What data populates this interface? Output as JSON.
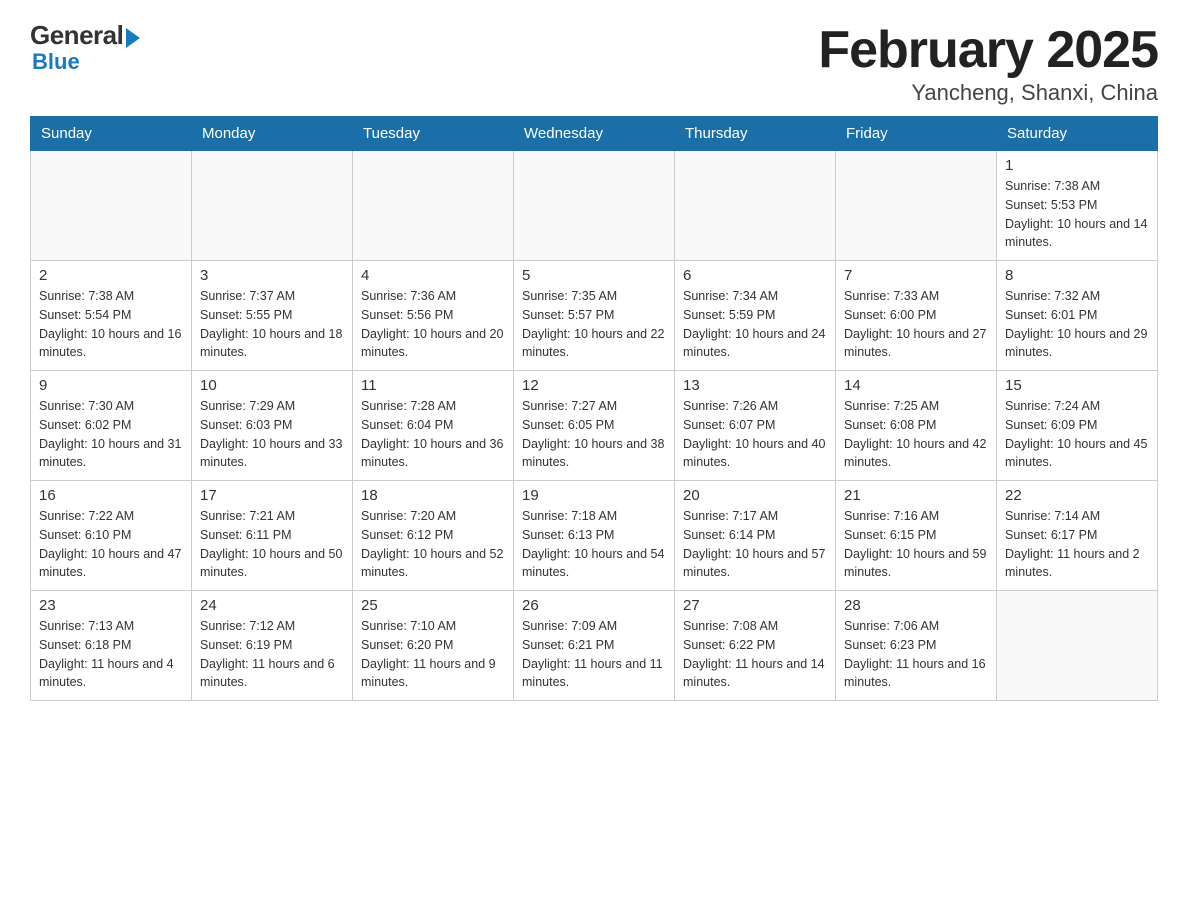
{
  "logo": {
    "general": "General",
    "blue": "Blue"
  },
  "title": "February 2025",
  "subtitle": "Yancheng, Shanxi, China",
  "days_of_week": [
    "Sunday",
    "Monday",
    "Tuesday",
    "Wednesday",
    "Thursday",
    "Friday",
    "Saturday"
  ],
  "weeks": [
    [
      {
        "day": "",
        "info": ""
      },
      {
        "day": "",
        "info": ""
      },
      {
        "day": "",
        "info": ""
      },
      {
        "day": "",
        "info": ""
      },
      {
        "day": "",
        "info": ""
      },
      {
        "day": "",
        "info": ""
      },
      {
        "day": "1",
        "info": "Sunrise: 7:38 AM\nSunset: 5:53 PM\nDaylight: 10 hours and 14 minutes."
      }
    ],
    [
      {
        "day": "2",
        "info": "Sunrise: 7:38 AM\nSunset: 5:54 PM\nDaylight: 10 hours and 16 minutes."
      },
      {
        "day": "3",
        "info": "Sunrise: 7:37 AM\nSunset: 5:55 PM\nDaylight: 10 hours and 18 minutes."
      },
      {
        "day": "4",
        "info": "Sunrise: 7:36 AM\nSunset: 5:56 PM\nDaylight: 10 hours and 20 minutes."
      },
      {
        "day": "5",
        "info": "Sunrise: 7:35 AM\nSunset: 5:57 PM\nDaylight: 10 hours and 22 minutes."
      },
      {
        "day": "6",
        "info": "Sunrise: 7:34 AM\nSunset: 5:59 PM\nDaylight: 10 hours and 24 minutes."
      },
      {
        "day": "7",
        "info": "Sunrise: 7:33 AM\nSunset: 6:00 PM\nDaylight: 10 hours and 27 minutes."
      },
      {
        "day": "8",
        "info": "Sunrise: 7:32 AM\nSunset: 6:01 PM\nDaylight: 10 hours and 29 minutes."
      }
    ],
    [
      {
        "day": "9",
        "info": "Sunrise: 7:30 AM\nSunset: 6:02 PM\nDaylight: 10 hours and 31 minutes."
      },
      {
        "day": "10",
        "info": "Sunrise: 7:29 AM\nSunset: 6:03 PM\nDaylight: 10 hours and 33 minutes."
      },
      {
        "day": "11",
        "info": "Sunrise: 7:28 AM\nSunset: 6:04 PM\nDaylight: 10 hours and 36 minutes."
      },
      {
        "day": "12",
        "info": "Sunrise: 7:27 AM\nSunset: 6:05 PM\nDaylight: 10 hours and 38 minutes."
      },
      {
        "day": "13",
        "info": "Sunrise: 7:26 AM\nSunset: 6:07 PM\nDaylight: 10 hours and 40 minutes."
      },
      {
        "day": "14",
        "info": "Sunrise: 7:25 AM\nSunset: 6:08 PM\nDaylight: 10 hours and 42 minutes."
      },
      {
        "day": "15",
        "info": "Sunrise: 7:24 AM\nSunset: 6:09 PM\nDaylight: 10 hours and 45 minutes."
      }
    ],
    [
      {
        "day": "16",
        "info": "Sunrise: 7:22 AM\nSunset: 6:10 PM\nDaylight: 10 hours and 47 minutes."
      },
      {
        "day": "17",
        "info": "Sunrise: 7:21 AM\nSunset: 6:11 PM\nDaylight: 10 hours and 50 minutes."
      },
      {
        "day": "18",
        "info": "Sunrise: 7:20 AM\nSunset: 6:12 PM\nDaylight: 10 hours and 52 minutes."
      },
      {
        "day": "19",
        "info": "Sunrise: 7:18 AM\nSunset: 6:13 PM\nDaylight: 10 hours and 54 minutes."
      },
      {
        "day": "20",
        "info": "Sunrise: 7:17 AM\nSunset: 6:14 PM\nDaylight: 10 hours and 57 minutes."
      },
      {
        "day": "21",
        "info": "Sunrise: 7:16 AM\nSunset: 6:15 PM\nDaylight: 10 hours and 59 minutes."
      },
      {
        "day": "22",
        "info": "Sunrise: 7:14 AM\nSunset: 6:17 PM\nDaylight: 11 hours and 2 minutes."
      }
    ],
    [
      {
        "day": "23",
        "info": "Sunrise: 7:13 AM\nSunset: 6:18 PM\nDaylight: 11 hours and 4 minutes."
      },
      {
        "day": "24",
        "info": "Sunrise: 7:12 AM\nSunset: 6:19 PM\nDaylight: 11 hours and 6 minutes."
      },
      {
        "day": "25",
        "info": "Sunrise: 7:10 AM\nSunset: 6:20 PM\nDaylight: 11 hours and 9 minutes."
      },
      {
        "day": "26",
        "info": "Sunrise: 7:09 AM\nSunset: 6:21 PM\nDaylight: 11 hours and 11 minutes."
      },
      {
        "day": "27",
        "info": "Sunrise: 7:08 AM\nSunset: 6:22 PM\nDaylight: 11 hours and 14 minutes."
      },
      {
        "day": "28",
        "info": "Sunrise: 7:06 AM\nSunset: 6:23 PM\nDaylight: 11 hours and 16 minutes."
      },
      {
        "day": "",
        "info": ""
      }
    ]
  ]
}
